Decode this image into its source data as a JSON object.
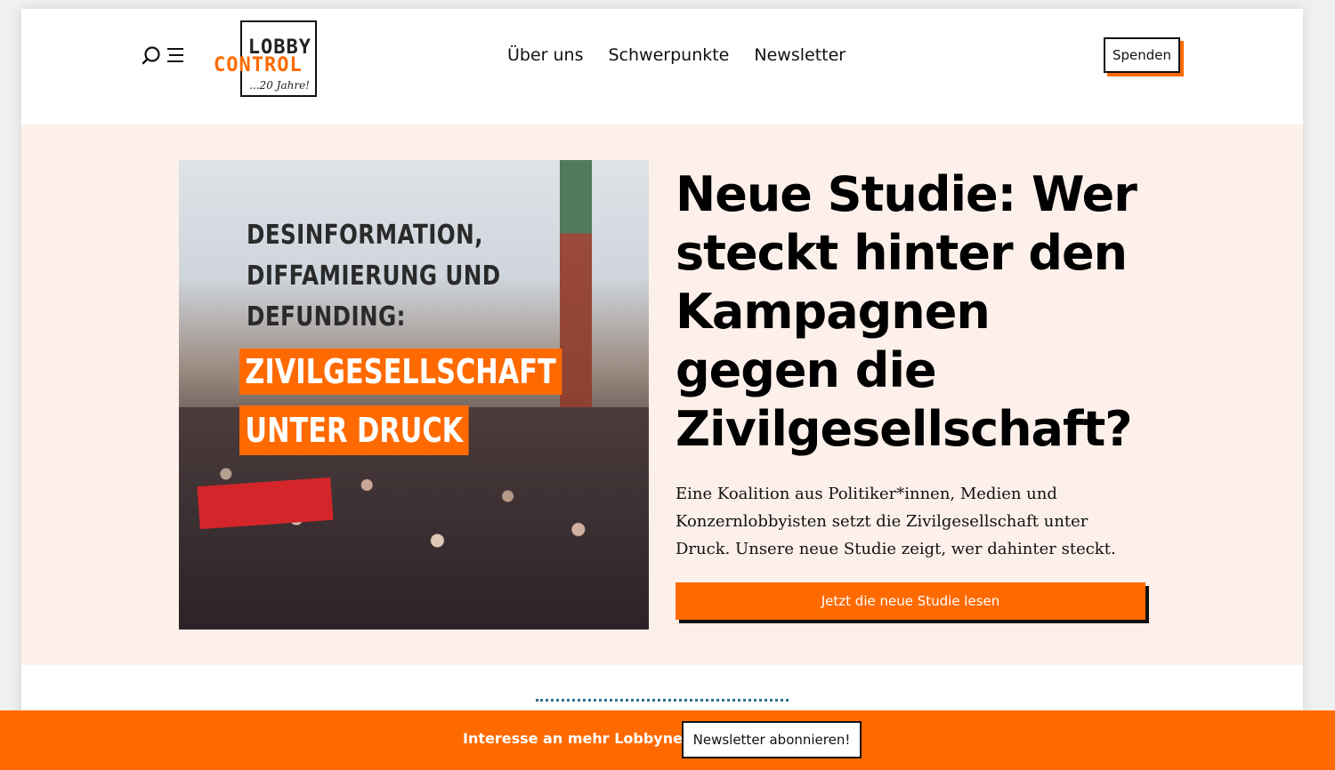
{
  "header": {
    "logo": {
      "line1": "LOBBY",
      "line2": "CONTROL",
      "tagline": "...20 Jahre!"
    },
    "nav": [
      {
        "label": "Über uns"
      },
      {
        "label": "Schwerpunkte"
      },
      {
        "label": "Newsletter"
      }
    ],
    "donate_label": "Spenden"
  },
  "hero": {
    "image_text": {
      "line1": "DESINFORMATION,",
      "line2": "DIFFAMIERUNG UND",
      "line3": "DEFUNDING:",
      "highlight1": "ZIVILGESELLSCHAFT",
      "highlight2": "UNTER DRUCK"
    },
    "title": "Neue Studie: Wer steckt hinter den Kampagnen gegen die Zivilgesellschaft?",
    "text": "Eine Koalition aus Politiker*innen, Medien und Konzernlobbyisten setzt die Zivilgesellschaft unter Druck. Unsere neue Studie zeigt, wer dahinter steckt.",
    "cta_label": "Jetzt die neue Studie lesen"
  },
  "newsletter_bar": {
    "question": "Interesse an mehr Lobbynews?",
    "button_label": "Newsletter abonnieren!"
  },
  "colors": {
    "accent": "#ff6a00",
    "hero_bg": "#fdf0ea",
    "text": "#111111"
  }
}
